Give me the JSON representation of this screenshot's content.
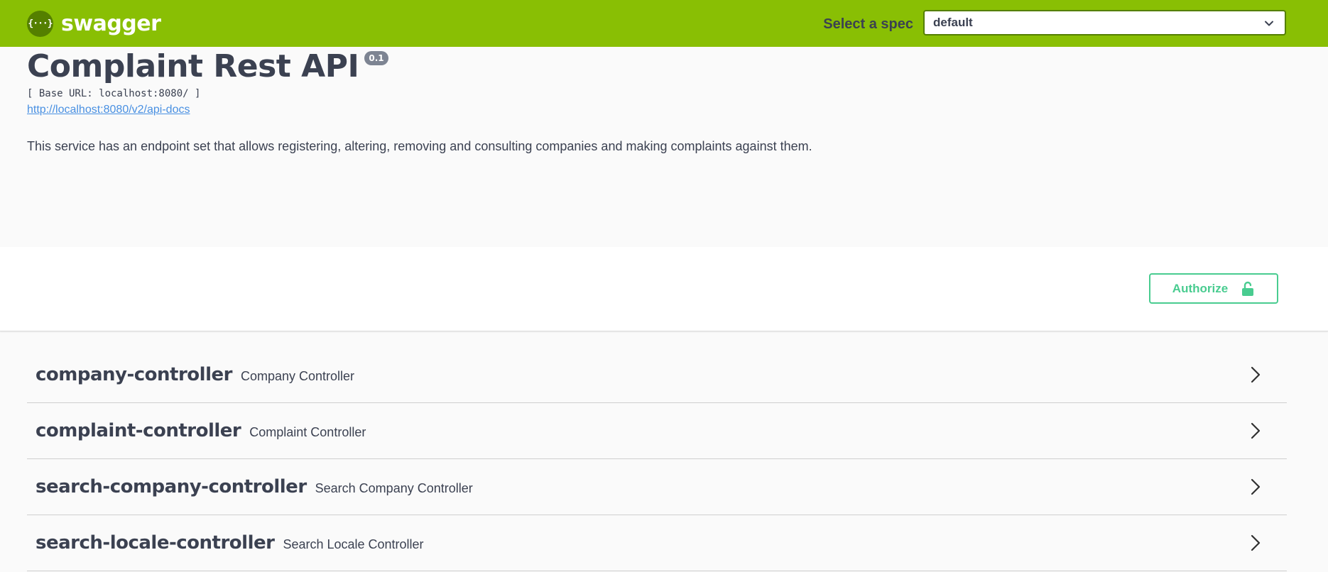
{
  "topbar": {
    "logo_symbol": "{···}",
    "logo_text": "swagger",
    "spec_label": "Select a spec",
    "spec_value": "default",
    "background_color": "#89bf04"
  },
  "info": {
    "title": "Complaint Rest API",
    "version": "0.1",
    "base_url": "[ Base URL: localhost:8080/ ]",
    "docs_link": "http://localhost:8080/v2/api-docs",
    "description": "This service has an endpoint set that allows registering, altering, removing and consulting companies and making complaints against them."
  },
  "auth": {
    "button_label": "Authorize",
    "accent_color": "#49cc90"
  },
  "controllers": [
    {
      "name": "company-controller",
      "description": "Company Controller"
    },
    {
      "name": "complaint-controller",
      "description": "Complaint Controller"
    },
    {
      "name": "search-company-controller",
      "description": "Search Company Controller"
    },
    {
      "name": "search-locale-controller",
      "description": "Search Locale Controller"
    }
  ],
  "icons": {
    "logo": "swagger-logo-icon",
    "spec_dropdown": "chevron-down-icon",
    "authorize": "unlocked-lock-icon",
    "controller_expand": "chevron-right-icon"
  }
}
